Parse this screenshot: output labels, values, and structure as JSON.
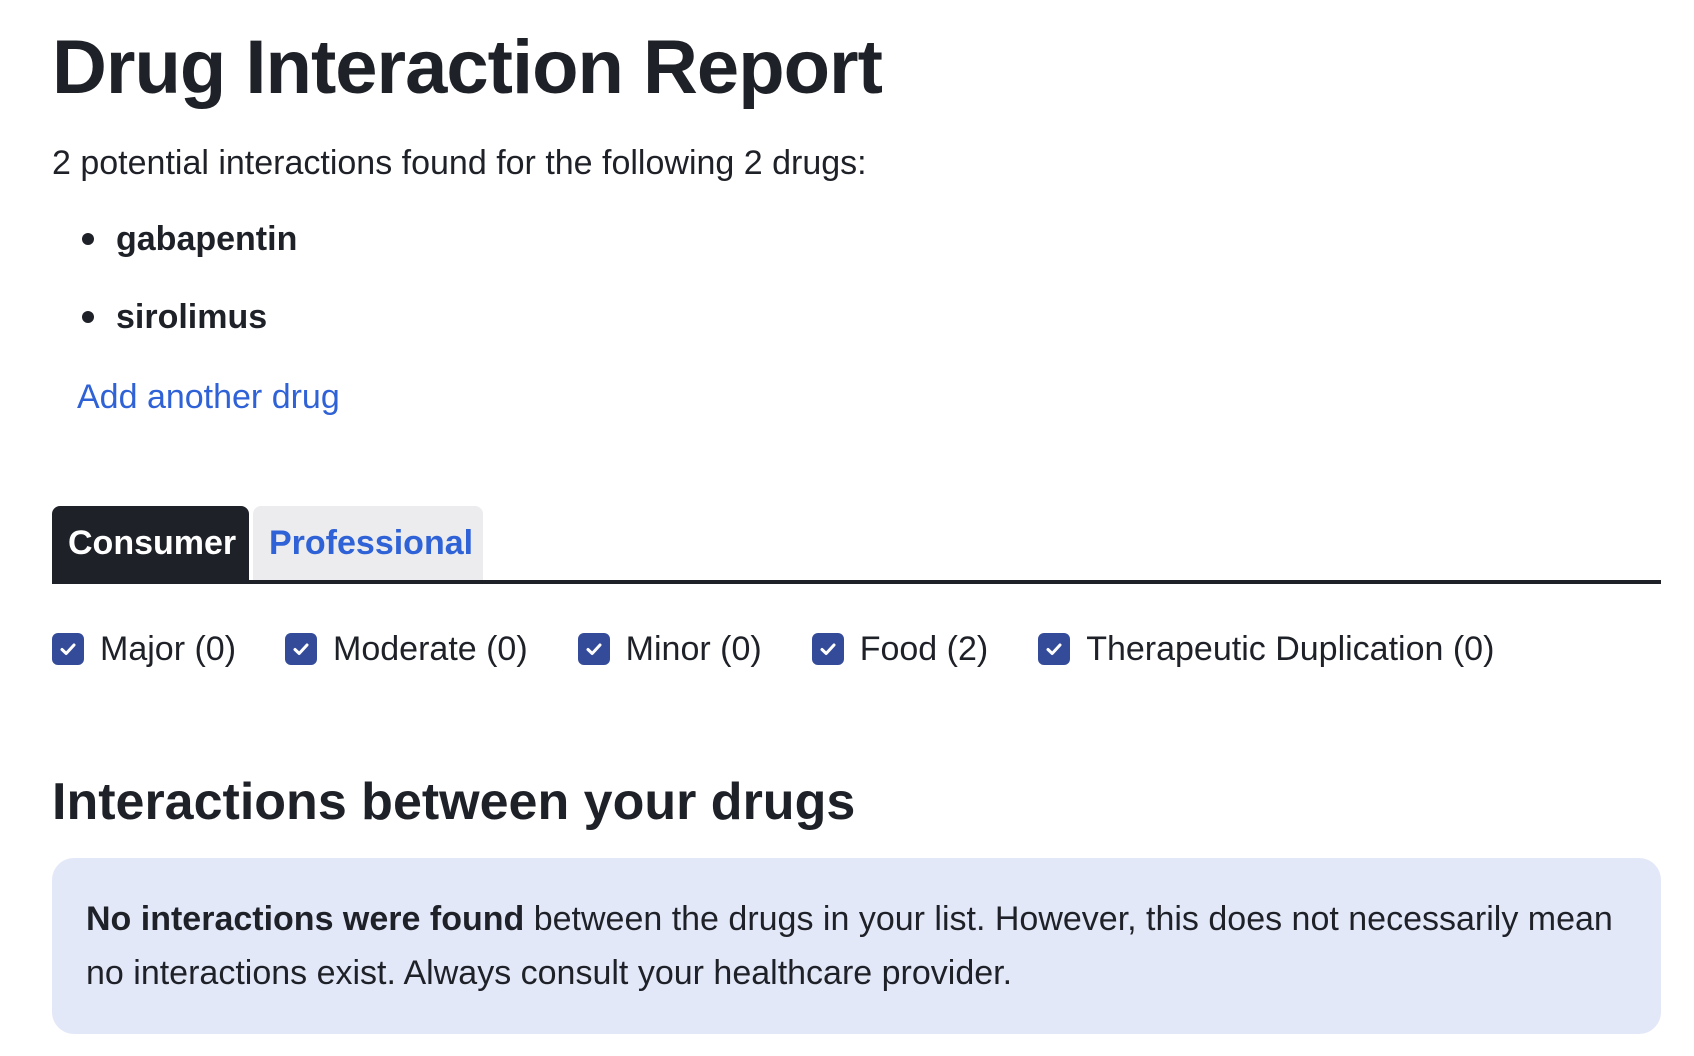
{
  "page_title": "Drug Interaction Report",
  "summary": "2 potential interactions found for the following 2 drugs:",
  "drugs": [
    {
      "name": "gabapentin"
    },
    {
      "name": "sirolimus"
    }
  ],
  "add_drug_link": "Add another drug",
  "tabs": [
    {
      "label": "Consumer",
      "active": true
    },
    {
      "label": "Professional",
      "active": false
    }
  ],
  "filters": [
    {
      "label": "Major (0)",
      "checked": true
    },
    {
      "label": "Moderate (0)",
      "checked": true
    },
    {
      "label": "Minor (0)",
      "checked": true
    },
    {
      "label": "Food (2)",
      "checked": true
    },
    {
      "label": "Therapeutic Duplication (0)",
      "checked": true
    }
  ],
  "section_heading": "Interactions between your drugs",
  "info_box": {
    "bold": "No interactions were found",
    "text": " between the drugs in your list. However, this does not necessarily mean no interactions exist. Always consult your healthcare provider."
  },
  "colors": {
    "text": "#1f2128",
    "link": "#2f62d6",
    "checkbox": "#344b9a",
    "info_bg": "#e3e8f8",
    "tab_inactive_bg": "#ececee"
  },
  "icons": {
    "checkbox": "checkmark-icon",
    "bullet": "bullet-icon"
  }
}
